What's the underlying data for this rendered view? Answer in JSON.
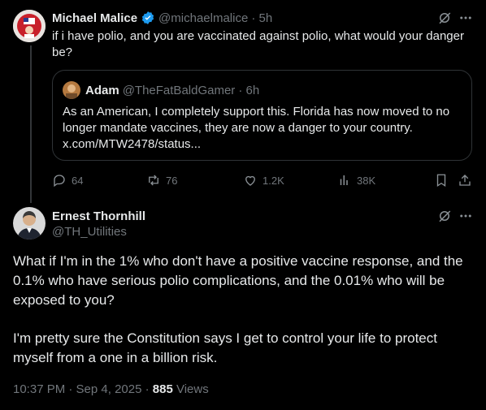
{
  "tweet1": {
    "display_name": "Michael Malice",
    "handle": "@michaelmalice",
    "time": "· 5h",
    "text": "if i have polio, and you are vaccinated against polio, what would your danger be?",
    "quote": {
      "display_name": "Adam",
      "handle": "@TheFatBaldGamer",
      "time": "· 6h",
      "text": "As an American, I completely support this. Florida has now moved to no longer mandate vaccines, they are now a danger to your country. x.com/MTW2478/status..."
    },
    "actions": {
      "replies": "64",
      "reposts": "76",
      "likes": "1.2K",
      "views": "38K"
    }
  },
  "tweet2": {
    "display_name": "Ernest Thornhill",
    "handle": "@TH_Utilities",
    "text_p1": "What if I'm in the 1% who don't have a positive vaccine response, and the 0.1% who have serious polio complications, and the 0.01% who will be exposed to you?",
    "text_p2": "I'm pretty sure the Constitution says I get to control your life to protect myself from a one in a billion risk.",
    "meta_time": "10:37 PM · Sep 4, 2025 · ",
    "views_count": "885",
    "views_label": " Views"
  },
  "colors": {
    "background": "#000000",
    "text": "#e7e9ea",
    "muted": "#71767b",
    "verified": "#1d9bf0",
    "border": "#2f3336"
  },
  "icons": [
    "verified-badge-icon",
    "grok-icon",
    "more-icon",
    "reply-icon",
    "repost-icon",
    "like-icon",
    "views-icon",
    "bookmark-icon",
    "share-icon"
  ]
}
